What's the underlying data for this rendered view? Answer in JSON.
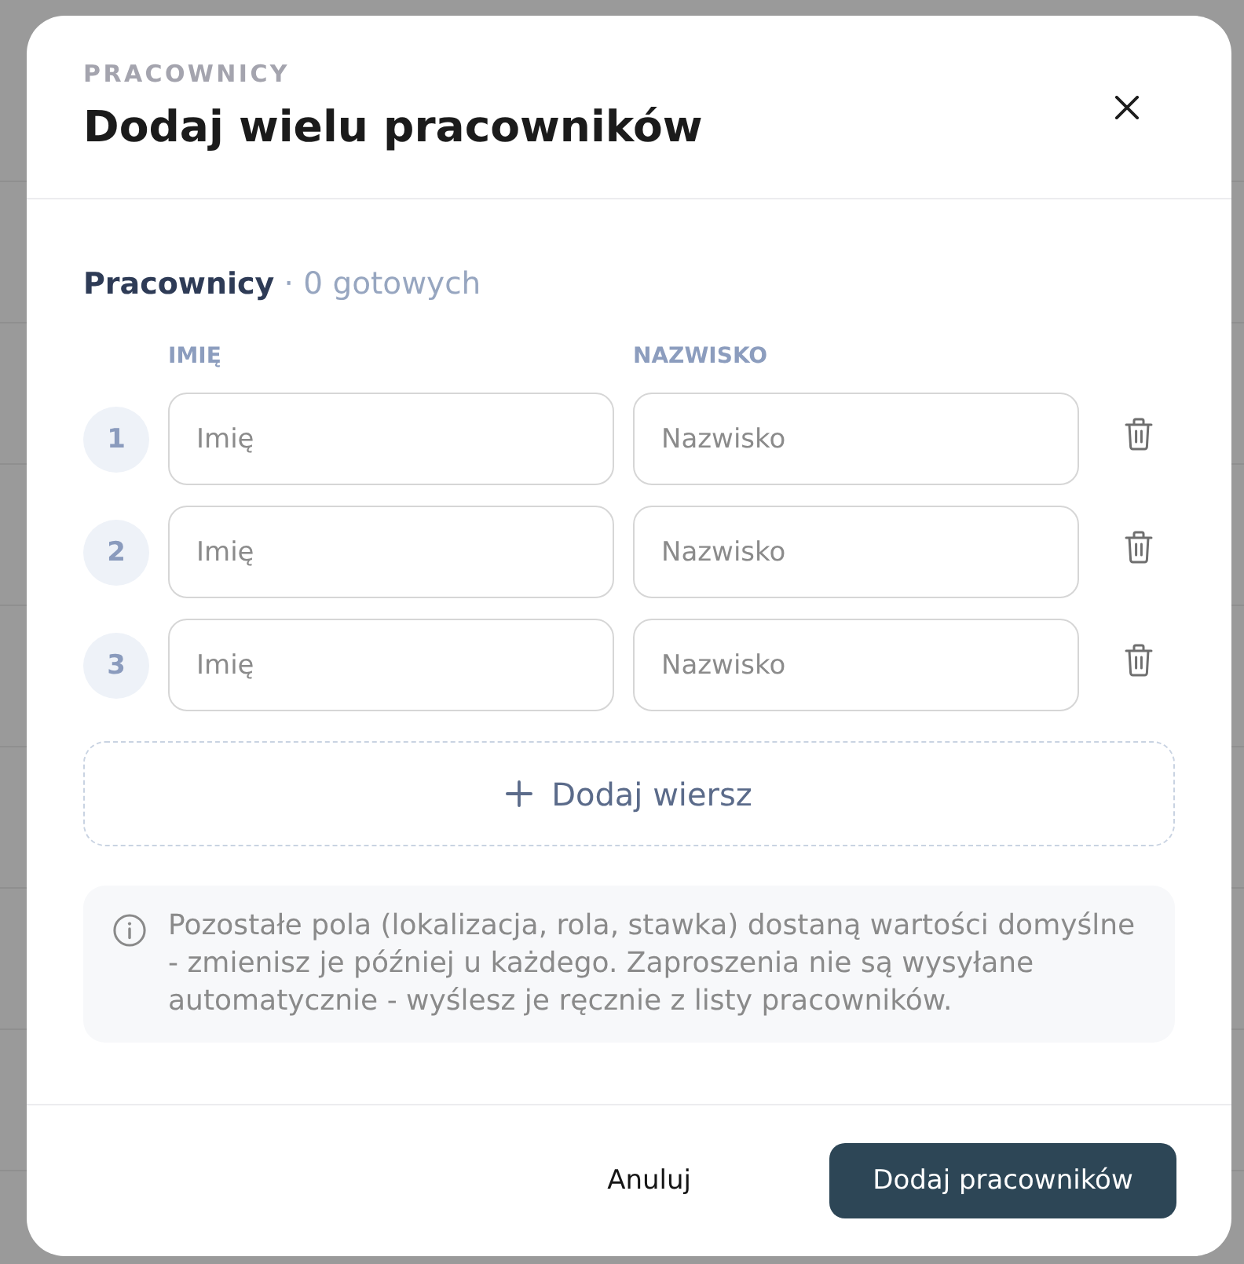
{
  "header": {
    "eyebrow": "PRACOWNICY",
    "title": "Dodaj wielu pracowników"
  },
  "section": {
    "title": "Pracownicy",
    "count": "· 0 gotowych"
  },
  "columns": [
    "IMIĘ",
    "NAZWISKO"
  ],
  "rows": [
    {
      "number": "1",
      "first_name": {
        "placeholder": "Imię"
      },
      "last_name": {
        "placeholder": "Nazwisko"
      }
    },
    {
      "number": "2",
      "first_name": {
        "placeholder": "Imię"
      },
      "last_name": {
        "placeholder": "Nazwisko"
      }
    },
    {
      "number": "3",
      "first_name": {
        "placeholder": "Imię"
      },
      "last_name": {
        "placeholder": "Nazwisko"
      }
    }
  ],
  "add_row_button": {
    "label": "Dodaj wiersz"
  },
  "info": {
    "text": "Pozostałe pola (lokalizacja, rola, stawka) dostaną wartości domyślne - zmienisz je później u każdego. Zaproszenia nie są wysyłane automatycznie - wyślesz je ręcznie z listy pracowników."
  },
  "footer": {
    "buttons": [
      {
        "label": "Anuluj",
        "kind": "secondary"
      },
      {
        "label": "Dodaj pracowników",
        "kind": "primary"
      }
    ]
  }
}
